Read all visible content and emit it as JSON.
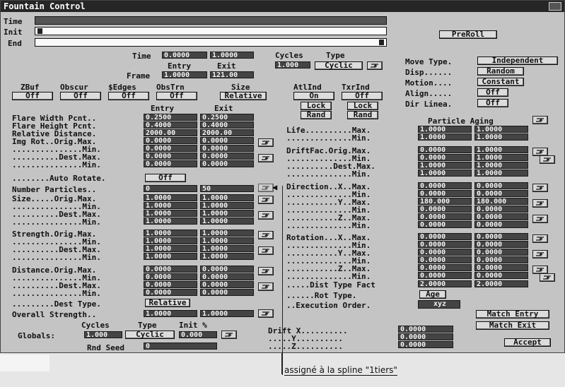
{
  "window": {
    "title": "Fountain Control"
  },
  "timeline": {
    "time_label": "Time",
    "init_label": "Init",
    "end_label": "End"
  },
  "preroll": "PreRoll",
  "time_row": {
    "time_label": "Time",
    "entry_value": "0.0000",
    "exit_value": "1.0000",
    "entry_label": "Entry",
    "exit_label": "Exit",
    "frame_label": "Frame",
    "frame_entry": "1.0000",
    "frame_exit": "121.00"
  },
  "cycles": {
    "cycles_label": "Cycles",
    "type_label": "Type",
    "value": "1.000",
    "type": "Cyclic"
  },
  "move": {
    "move_type_label": "Move Type.",
    "move_type": "Independent",
    "disp_label": "Disp......",
    "disp": "Random",
    "motion_label": "Motion....",
    "motion": "Constant",
    "align_label": "Align.....",
    "align": "Off",
    "dir_label": "Dir Linea.",
    "dir": "Off"
  },
  "toggles": [
    {
      "label": "ZBuf",
      "value": "Off"
    },
    {
      "label": "Obscur",
      "value": "Off"
    },
    {
      "label": "$Edges",
      "value": "Off"
    },
    {
      "label": "ObsTrn",
      "value": "Off"
    },
    {
      "label": "Size",
      "value": "Relative"
    }
  ],
  "atlind": {
    "label": "AtlInd",
    "value": "On",
    "lock": "Lock",
    "rand": "Rand"
  },
  "txrind": {
    "label": "TxrInd",
    "value": "Off",
    "lock": "Lock",
    "rand": "Rand"
  },
  "cols": {
    "entry": "Entry",
    "exit": "Exit"
  },
  "left_rows": [
    {
      "label": "Flare Width Pcnt..",
      "a": "0.2500",
      "b": "0.2500"
    },
    {
      "label": "Flare Height Pcnt.",
      "a": "0.4000",
      "b": "0.4000"
    },
    {
      "label": "Relative Distance.",
      "a": "2000.00",
      "b": "2000.00"
    },
    {
      "label": "Img Rot..Orig.Max.",
      "a": "0.0000",
      "b": "0.0000"
    },
    {
      "label": "...............Min.",
      "a": "0.0000",
      "b": "0.0000"
    },
    {
      "label": "..........Dest.Max.",
      "a": "0.0000",
      "b": "0.0000"
    },
    {
      "label": "...............Min.",
      "a": "0.0000",
      "b": "0.0000"
    }
  ],
  "auto_rotate": {
    "label": "........Auto Rotate.",
    "value": "Off"
  },
  "number_particles": {
    "label": "Number Particles..",
    "a": "0",
    "b": "50"
  },
  "size_rows": [
    {
      "label": "Size.....Orig.Max.",
      "a": "1.0000",
      "b": "1.0000"
    },
    {
      "label": "...............Min.",
      "a": "1.0000",
      "b": "1.0000"
    },
    {
      "label": "..........Dest.Max.",
      "a": "1.0000",
      "b": "1.0000"
    },
    {
      "label": "...............Min.",
      "a": "1.0000",
      "b": "1.0000"
    }
  ],
  "strength_rows": [
    {
      "label": "Strength.Orig.Max.",
      "a": "1.0000",
      "b": "1.0000"
    },
    {
      "label": "...............Min.",
      "a": "1.0000",
      "b": "1.0000"
    },
    {
      "label": "..........Dest.Max.",
      "a": "1.0000",
      "b": "1.0000"
    },
    {
      "label": "...............Min.",
      "a": "1.0000",
      "b": "1.0000"
    }
  ],
  "distance_rows": [
    {
      "label": "Distance.Orig.Max.",
      "a": "0.0000",
      "b": "0.0000"
    },
    {
      "label": "...............Min.",
      "a": "0.0000",
      "b": "0.0000"
    },
    {
      "label": "..........Dest.Max.",
      "a": "0.0000",
      "b": "0.0000"
    },
    {
      "label": "...............Min.",
      "a": "0.0000",
      "b": "0.0000"
    }
  ],
  "dest_type": {
    "label": ".........Dest Type.",
    "value": "Relative"
  },
  "overall_strength": {
    "label": "Overall Strength..",
    "a": "1.0000",
    "b": "1.0000"
  },
  "globals": {
    "label": "Globals:",
    "cycles_label": "Cycles",
    "type_label": "Type",
    "init_label": "Init %",
    "cycles": "1.000",
    "type": "Cyclic",
    "init": "0.000",
    "rnd_label": "Rnd Seed",
    "rnd": "0"
  },
  "particle_aging": "Particle Aging",
  "right_rows": [
    {
      "label": "Life..........Max.",
      "a": "1.0000",
      "b": "1.0000"
    },
    {
      "label": "..............Min.",
      "a": "1.0000",
      "b": "1.0000"
    },
    {
      "label": "DriftFac.Orig.Max.",
      "a": "0.0000",
      "b": "1.0000"
    },
    {
      "label": "..............Min.",
      "a": "0.0000",
      "b": "1.0000"
    },
    {
      "label": "..........Dest.Max.",
      "a": "1.0000",
      "b": "1.0000"
    },
    {
      "label": "..............Min.",
      "a": "1.0000",
      "b": "1.0000"
    },
    {
      "label": "Direction..X..Max.",
      "a": "0.0000",
      "b": "0.0000"
    },
    {
      "label": "..............Min.",
      "a": "0.0000",
      "b": "0.0000"
    },
    {
      "label": "...........Y..Max.",
      "a": "180.000",
      "b": "180.000"
    },
    {
      "label": "..............Min.",
      "a": "0.0000",
      "b": "0.0000"
    },
    {
      "label": "...........Z..Max.",
      "a": "0.0000",
      "b": "0.0000"
    },
    {
      "label": "..............Min.",
      "a": "0.0000",
      "b": "0.0000"
    },
    {
      "label": "Rotation...X..Max.",
      "a": "0.0000",
      "b": "0.0000"
    },
    {
      "label": "..............Min.",
      "a": "0.0000",
      "b": "0.0000"
    },
    {
      "label": "...........Y..Max.",
      "a": "0.0000",
      "b": "0.0000"
    },
    {
      "label": "..............Min.",
      "a": "0.0000",
      "b": "0.0000"
    },
    {
      "label": "...........Z..Max.",
      "a": "0.0000",
      "b": "0.0000"
    },
    {
      "label": "..............Min.",
      "a": "0.0000",
      "b": "0.0000"
    },
    {
      "label": ".....Dist Type Fact",
      "a": "2.0000",
      "b": "2.0000"
    }
  ],
  "rot_type": {
    "label": "......Rot Type.",
    "value": "Age"
  },
  "exec_order": {
    "label": "..Execution Order.",
    "value": "xyz"
  },
  "drift": {
    "x_label": "Drift X..........",
    "y_label": ".....Y..........",
    "z_label": ".....Z..........",
    "x": "0.0000",
    "y": "0.0000",
    "z": "0.0000"
  },
  "buttons": {
    "match_entry": "Match Entry",
    "match_exit": "Match Exit",
    "accept": "Accept"
  },
  "annotation": "assigné à la spline \"1tiers\""
}
